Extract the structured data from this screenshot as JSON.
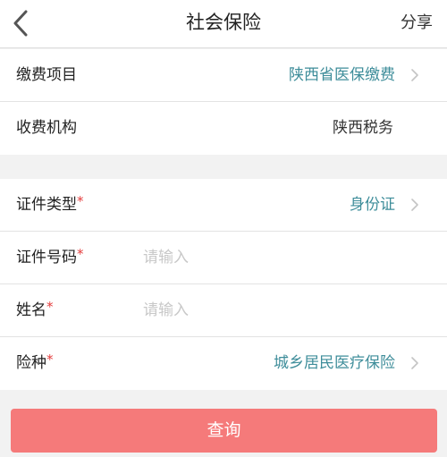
{
  "header": {
    "title": "社会保险",
    "share_label": "分享",
    "back_icon": "chevron-left-icon"
  },
  "section1": {
    "item": {
      "label": "缴费项目",
      "value": "陕西省医保缴费"
    },
    "org": {
      "label": "收费机构",
      "value": "陕西税务"
    }
  },
  "section2": {
    "id_type": {
      "label": "证件类型",
      "required_mark": "*",
      "value": "身份证"
    },
    "id_number": {
      "label": "证件号码",
      "required_mark": "*",
      "placeholder": "请输入"
    },
    "name": {
      "label": "姓名",
      "required_mark": "*",
      "placeholder": "请输入"
    },
    "insurance": {
      "label": "险种",
      "required_mark": "*",
      "value": "城乡居民医疗保险"
    }
  },
  "actions": {
    "query_label": "查询"
  },
  "colors": {
    "accent": "#3e8d9a",
    "required": "#e43c3c",
    "button": "#f57a7a",
    "background": "#f2f2f2"
  }
}
